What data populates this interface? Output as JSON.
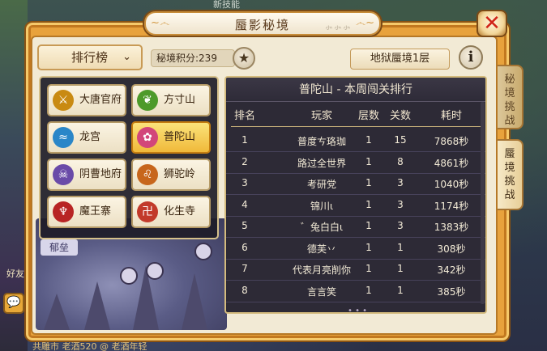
{
  "window": {
    "title": "蜃影秘境",
    "close_glyph": "✕"
  },
  "toolbar": {
    "rank_label": "排行榜",
    "rank_chevron": "⌄",
    "score_text": "秘境积分:239",
    "star_glyph": "★",
    "level_label": "地狱蜃境1层",
    "info_glyph": "i"
  },
  "side_tabs": [
    {
      "label": "秘境挑战"
    },
    {
      "label": "蜃境挑战"
    }
  ],
  "sects": [
    {
      "label": "大唐官府",
      "icon": "sword-emblem-icon",
      "color": "#c98a12",
      "active": false
    },
    {
      "label": "方寸山",
      "icon": "leaf-emblem-icon",
      "color": "#4d9a2a",
      "active": false
    },
    {
      "label": "龙宫",
      "icon": "wave-emblem-icon",
      "color": "#2a86c8",
      "active": false
    },
    {
      "label": "普陀山",
      "icon": "lotus-emblem-icon",
      "color": "#d2467a",
      "active": true
    },
    {
      "label": "阴曹地府",
      "icon": "skull-emblem-icon",
      "color": "#6a4aa8",
      "active": false
    },
    {
      "label": "狮驼岭",
      "icon": "lion-emblem-icon",
      "color": "#c7661c",
      "active": false
    },
    {
      "label": "魔王寨",
      "icon": "demon-emblem-icon",
      "color": "#b82424",
      "active": false
    },
    {
      "label": "化生寺",
      "icon": "temple-emblem-icon",
      "color": "#c23a2a",
      "active": false
    }
  ],
  "ranking": {
    "title": "普陀山 - 本周闯关排行",
    "headers": [
      "排名",
      "玩家",
      "层数",
      "关数",
      "耗时"
    ],
    "rows": [
      {
        "rank": "1",
        "player": "普度ㄘ珞珈",
        "floor": "1",
        "stage": "15",
        "time": "7868秒"
      },
      {
        "rank": "2",
        "player": "路过全世界",
        "floor": "1",
        "stage": "8",
        "time": "4861秒"
      },
      {
        "rank": "3",
        "player": "考研党",
        "floor": "1",
        "stage": "3",
        "time": "1040秒"
      },
      {
        "rank": "4",
        "player": "锦川ι",
        "floor": "1",
        "stage": "3",
        "time": "1174秒"
      },
      {
        "rank": "5",
        "player": "゛兔白白ι",
        "floor": "1",
        "stage": "3",
        "time": "1383秒"
      },
      {
        "rank": "6",
        "player": "德芙丷",
        "floor": "1",
        "stage": "1",
        "time": "308秒"
      },
      {
        "rank": "7",
        "player": "代表月亮削你",
        "floor": "1",
        "stage": "1",
        "time": "342秒"
      },
      {
        "rank": "8",
        "player": "言言笑",
        "floor": "1",
        "stage": "1",
        "time": "385秒"
      }
    ]
  },
  "scene": {
    "label": "郁垒"
  },
  "background": {
    "top_text": "新技能",
    "left_label": "好友",
    "bottom_text": "共雕市 老酒520 @ 老酒年轻"
  }
}
